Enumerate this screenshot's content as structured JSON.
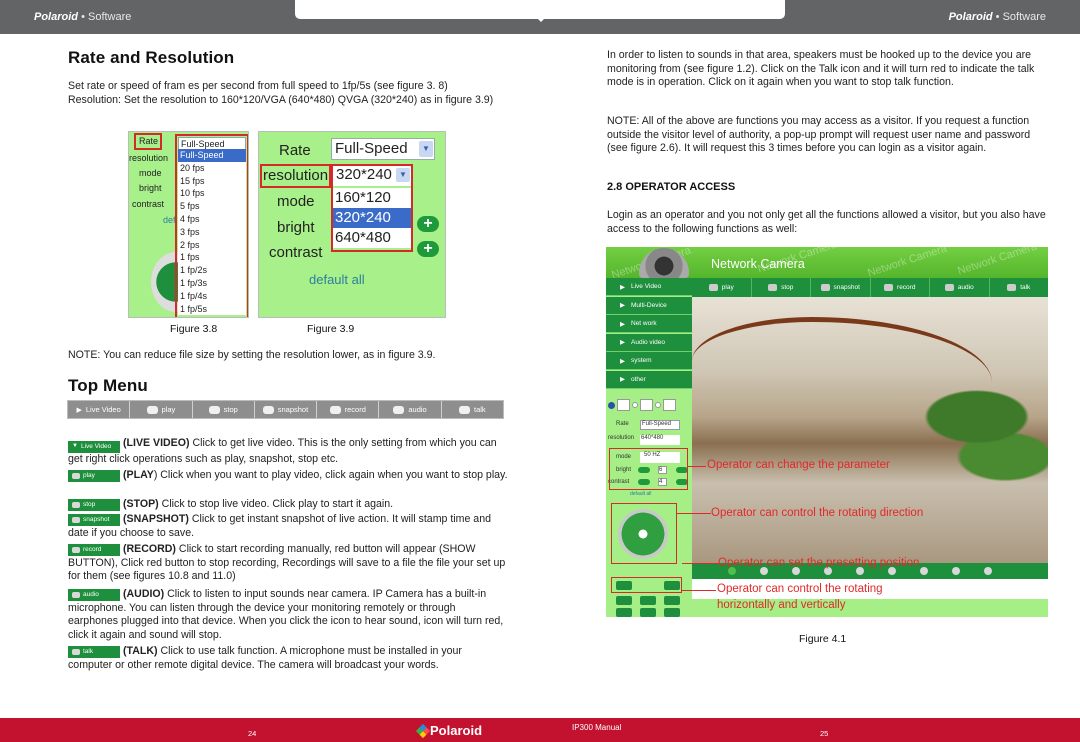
{
  "header": {
    "brand_left": "Polaroid",
    "brand_left_suffix": "• Software",
    "brand_right": "Polaroid",
    "brand_right_suffix": "• Software"
  },
  "left": {
    "section1_title": "Rate and Resolution",
    "section1_body": "Set rate or speed of fram es per second from full speed to 1fp/5s (see figure 3. 8) Resolution: Set the resolution to 160*120/VGA (640*480) QVGA (320*240) as in figure 3.9)",
    "figure38": {
      "caption": "Figure 3.8",
      "labels": [
        "Rate",
        "resolution",
        "mode",
        "bright",
        "contrast",
        "def"
      ],
      "select_value": "Full-Speed",
      "options": [
        "Full-Speed",
        "20 fps",
        "15 fps",
        "10 fps",
        "5 fps",
        "4 fps",
        "3 fps",
        "2 fps",
        "1 fps",
        "1 fp/2s",
        "1 fp/3s",
        "1 fp/4s",
        "1 fp/5s"
      ],
      "selected_option": "Full-Speed"
    },
    "figure39": {
      "caption": "Figure 3.9",
      "labels": [
        "Rate",
        "resolution",
        "mode",
        "bright",
        "contrast"
      ],
      "rate_value": "Full-Speed",
      "resolution_value": "320*240",
      "options": [
        "160*120",
        "320*240",
        "640*480"
      ],
      "selected_option": "320*240",
      "default_all": "default all"
    },
    "note": "NOTE: You can reduce file size by setting the resolution lower, as in figure 3.9.",
    "section2_title": "Top Menu",
    "menubar": [
      {
        "label": "Live Video",
        "icon": "play-triangle-icon"
      },
      {
        "label": "play",
        "icon": "play-icon"
      },
      {
        "label": "stop",
        "icon": "stop-icon"
      },
      {
        "label": "snapshot",
        "icon": "camera-icon"
      },
      {
        "label": "record",
        "icon": "record-icon"
      },
      {
        "label": "audio",
        "icon": "headphones-icon"
      },
      {
        "label": "talk",
        "icon": "microphone-icon"
      }
    ],
    "items": [
      {
        "chip": "Live Video",
        "title": "(LIVE VIDEO)",
        "text": " Click to get live video. This is the only setting from which you can get right click operations such as play, snapshot, stop etc."
      },
      {
        "chip": "play",
        "title": "(PLAY",
        "text": ") Click when you want to play video, click again when you want to stop play."
      },
      {
        "chip": "stop",
        "title": "(STOP)",
        "text": " Click to stop live video. Click play to start it again."
      },
      {
        "chip": "snapshot",
        "title": "(SNAPSHOT)",
        "text": " Click to get instant snapshot of live action. It will stamp time and date if you choose to save."
      },
      {
        "chip": "record",
        "title": "(RECORD)",
        "text": " Click to start recording manually, red button will appear (SHOW BUTTON), Click red button to stop recording, Recordings will save to a file the file your set up for them (see figures 10.8 and 11.0)"
      },
      {
        "chip": "audio",
        "title": "(AUDIO)",
        "text": " Click to listen to input sounds near camera. IP Camera has a built-in microphone. You can listen through the device your monitoring remotely or through earphones plugged into that device. When you click the icon to hear sound, icon will turn red, click it again and sound will stop."
      },
      {
        "chip": "talk",
        "title": "(TALK)",
        "text": " Click to use talk function. A microphone must be installed in your computer or other remote digital device. The camera will broadcast your words."
      }
    ]
  },
  "right": {
    "para1": "In order to listen to sounds in that area, speakers must be hooked up to the device  you are monitoring from (see figure 1.2). Click on the Talk icon and it will turn red to indicate the talk mode is in operation. Click on it again when you want to stop talk function.",
    "para2": "NOTE: All of the above are functions you may access as a visitor. If you request a function outside the visitor level of authority, a pop-up prompt will request user name and password (see figure 2.6). It will request this 3 times before you can login as a visitor again.",
    "section_title": "2.8 OPERATOR ACCESS",
    "para3": "Login as an operator and you not only get all the functions allowed a visitor, but you also have access to the following functions as well:",
    "figure41": {
      "caption": "Figure 4.1",
      "app_title": "Network Camera",
      "watermark": "Network Camera",
      "sidebar": [
        "Live Video",
        "Multi-Device",
        "Net work",
        "Audio video",
        "system",
        "other"
      ],
      "toolbar": [
        "play",
        "stop",
        "snapshot",
        "record",
        "audio",
        "talk"
      ],
      "params": {
        "rate_label": "Rate",
        "rate_value": "Full-Speed",
        "resolution_label": "resolution",
        "resolution_value": "640*480",
        "mode_label": "mode",
        "mode_value": "50 HZ",
        "bright_label": "bright",
        "bright_value": "6",
        "contrast_label": "contrast",
        "contrast_value": "4",
        "default_all": "default all"
      },
      "annotations": [
        "Operator can change the parameter",
        "Operator can control the rotating direction",
        "Operator can set the presetting position",
        "Operator can control the rotating",
        "horizontally and vertically"
      ],
      "preset_count": 9
    }
  },
  "footer": {
    "page_left": "24",
    "logo": "Polaroid",
    "manual": "IP300 Manual",
    "page_right": "25"
  },
  "colors": {
    "header_gray": "#636466",
    "footer_red": "#c3122f",
    "ui_green": "#1e8f3c",
    "panel_green": "#a6ee86",
    "annotation_red": "#e02a2a"
  }
}
